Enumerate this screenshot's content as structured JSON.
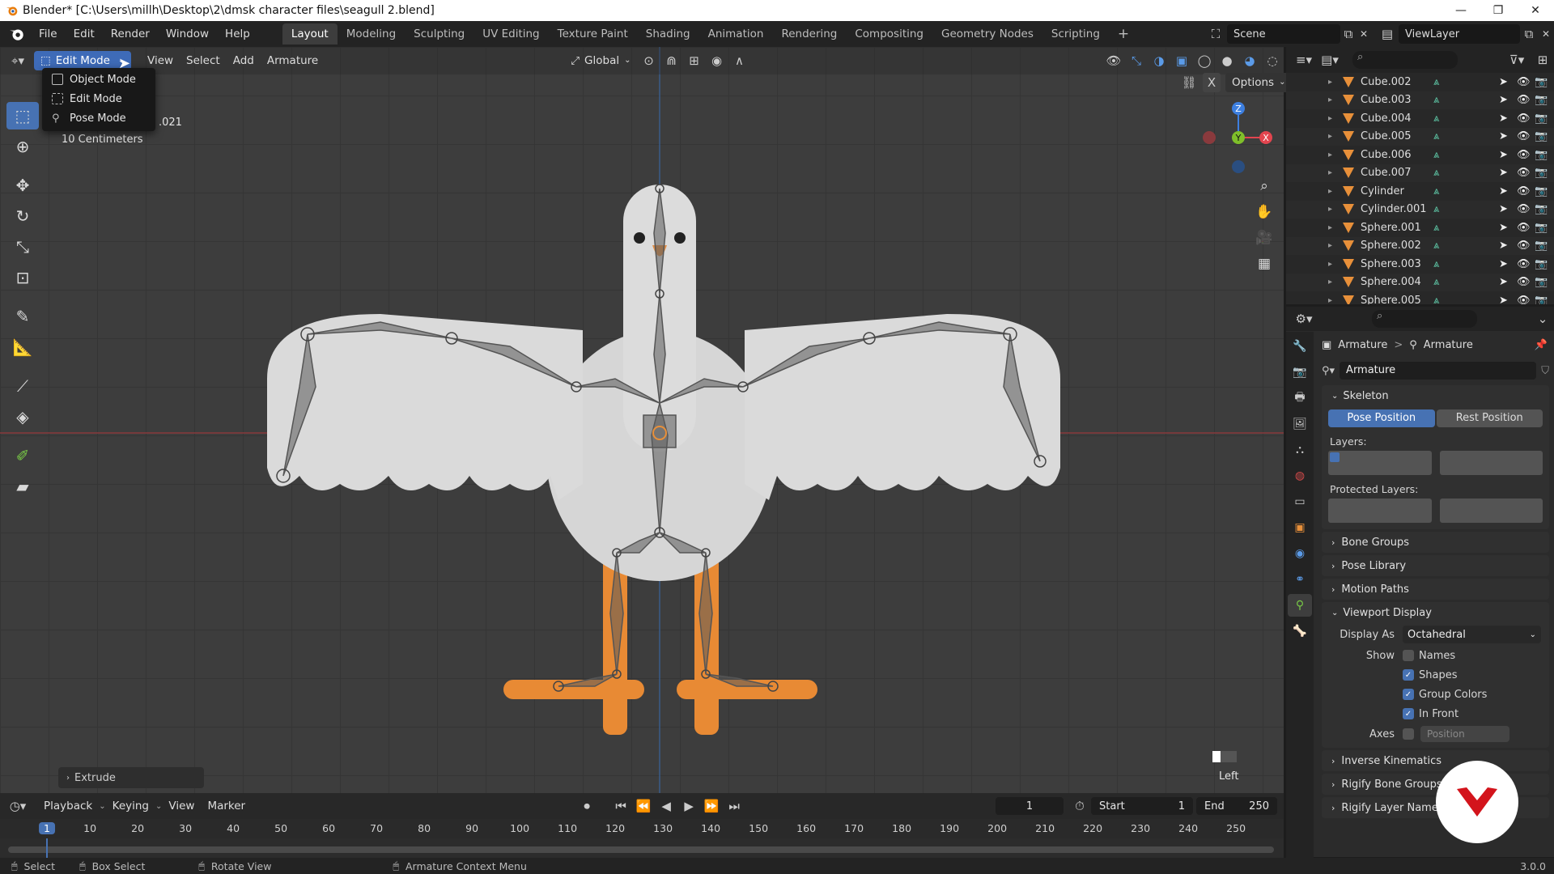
{
  "window": {
    "title": "Blender* [C:\\Users\\millh\\Desktop\\2\\dmsk character files\\seagull 2.blend]",
    "minimize_icon": "minimize-icon",
    "maximize_icon": "restore-icon",
    "close_icon": "close-icon"
  },
  "menubar": {
    "items": [
      "File",
      "Edit",
      "Render",
      "Window",
      "Help"
    ],
    "workspaces": [
      "Layout",
      "Modeling",
      "Sculpting",
      "UV Editing",
      "Texture Paint",
      "Shading",
      "Animation",
      "Rendering",
      "Compositing",
      "Geometry Nodes",
      "Scripting"
    ],
    "active_workspace": "Layout",
    "add_workspace": "+",
    "scene": "Scene",
    "view_layer": "ViewLayer"
  },
  "viewport": {
    "mode": "Edit Mode",
    "menus": [
      "View",
      "Select",
      "Add",
      "Armature"
    ],
    "transform_orientation": "Global",
    "options_label": "Options",
    "info_line1": ".021",
    "info_line2": "10 Centimeters",
    "view_label": "Left",
    "last_operator": "Extrude",
    "gizmo": {
      "x": "X",
      "y": "Y",
      "z": "Z"
    }
  },
  "mode_dropdown": {
    "items": [
      "Object Mode",
      "Edit Mode",
      "Pose Mode"
    ]
  },
  "outliner": {
    "rows": [
      "Cube.002",
      "Cube.003",
      "Cube.004",
      "Cube.005",
      "Cube.006",
      "Cube.007",
      "Cylinder",
      "Cylinder.001",
      "Sphere.001",
      "Sphere.002",
      "Sphere.003",
      "Sphere.004",
      "Sphere.005"
    ]
  },
  "properties": {
    "breadcrumb_1": "Armature",
    "breadcrumb_sep": ">",
    "breadcrumb_2": "Armature",
    "datablock_name": "Armature",
    "skeleton": {
      "title": "Skeleton",
      "pose_position": "Pose Position",
      "rest_position": "Rest Position",
      "layers_label": "Layers:",
      "protected_layers_label": "Protected Layers:"
    },
    "collapsed_panels": [
      "Bone Groups",
      "Pose Library",
      "Motion Paths"
    ],
    "viewport_display": {
      "title": "Viewport Display",
      "display_as_label": "Display As",
      "display_as_value": "Octahedral",
      "show_label": "Show",
      "names": "Names",
      "shapes": "Shapes",
      "group_colors": "Group Colors",
      "in_front": "In Front",
      "axes_label": "Axes",
      "axes_position": "Position"
    },
    "lower_panels": [
      "Inverse Kinematics",
      "Rigify Bone Groups",
      "Rigify Layer Names"
    ]
  },
  "timeline": {
    "menus": [
      "Playback",
      "Keying",
      "View",
      "Marker"
    ],
    "current_frame": "1",
    "start_label": "Start",
    "start_value": "1",
    "end_label": "End",
    "end_value": "250",
    "ruler": [
      "1",
      "10",
      "20",
      "30",
      "40",
      "50",
      "60",
      "70",
      "80",
      "90",
      "100",
      "110",
      "120",
      "130",
      "140",
      "150",
      "160",
      "170",
      "180",
      "190",
      "200",
      "210",
      "220",
      "230",
      "240",
      "250"
    ]
  },
  "statusbar": {
    "select": "Select",
    "box_select": "Box Select",
    "rotate_view": "Rotate View",
    "context_menu": "Armature Context Menu",
    "version": "3.0.0"
  },
  "colors": {
    "accent_blue": "#4772b3",
    "mode_blue": "#3e6bb8",
    "orange": "#e8903a",
    "axis_x": "#e2454f",
    "axis_y": "#7fbf2a",
    "axis_z": "#3d7fe0"
  }
}
